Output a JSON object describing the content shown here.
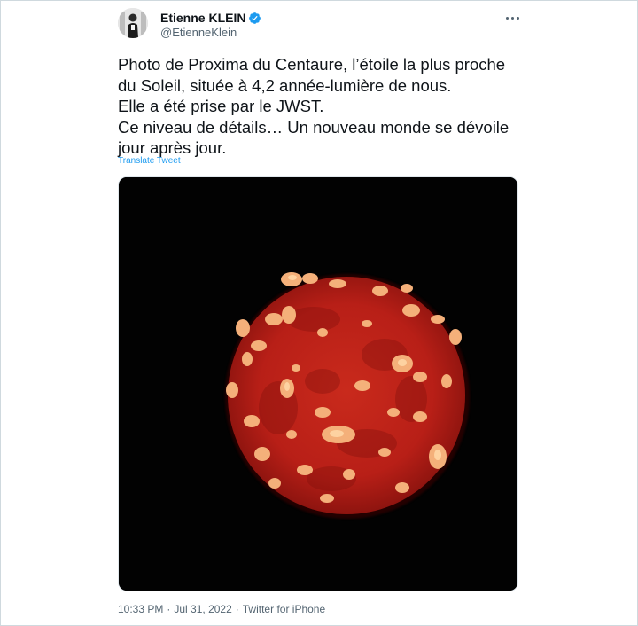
{
  "author": {
    "display_name": "Etienne KLEIN",
    "handle": "@EtienneKlein",
    "verified": true,
    "verified_color": "#1d9bf0"
  },
  "tweet": {
    "lines": [
      "Photo de Proxima du Centaure, l’étoile la plus proche",
      "du Soleil, située à 4,2 année-lumière de nous.",
      "Elle a été prise par le JWST.",
      "Ce niveau de détails… Un nouveau monde se dévoile",
      "jour après jour."
    ],
    "translate_label": "Translate Tweet",
    "time": "10:33 PM",
    "separator": "·",
    "date": "Jul 31, 2022",
    "source": "Twitter for iPhone"
  },
  "icons": {
    "more": "more-options-icon",
    "verified": "verified-badge-icon"
  },
  "colors": {
    "text": "#0f1419",
    "secondary": "#536471",
    "link": "#1d9bf0",
    "media_background": "#020202",
    "disc_red": "#c4231a"
  }
}
